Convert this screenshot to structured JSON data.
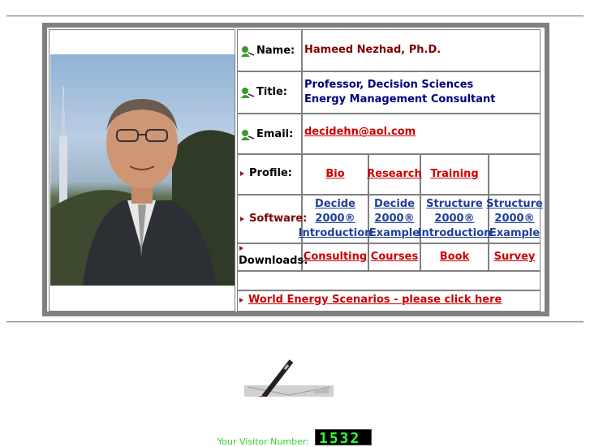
{
  "profile": {
    "name_label": "Name:",
    "name": "Hameed Nezhad, Ph.D.",
    "title_label": "Title:",
    "title_line1": "Professor, Decision Sciences",
    "title_line2": "Energy Management Consultant",
    "email_label": "Email:",
    "email": "decidehn@aol.com"
  },
  "rows": {
    "profile_label": "Profile:",
    "profile_links": [
      "Bio",
      "Research",
      "Training"
    ],
    "software_label": "Software:",
    "software_links": [
      [
        "Decide",
        "2000®",
        "Introduction"
      ],
      [
        "Decide",
        "2000®",
        "Example"
      ],
      [
        "Structure",
        "2000®",
        "Introduction"
      ],
      [
        "Structure",
        "2000®",
        "Example"
      ]
    ],
    "downloads_label": "Downloads:",
    "downloads_links": [
      "Consulting",
      "Courses",
      "Book",
      "Survey"
    ],
    "scenario_link": "World Energy Scenarios - please click here"
  },
  "counter": {
    "label": "Your Visitor Number:",
    "digits": "1532"
  },
  "colors": {
    "link": "#cc0000",
    "software_link": "#1f3f9a",
    "name_text": "#800000",
    "title_text": "#000080",
    "counter_digit": "#33ff33"
  },
  "icons": [
    "green-person-icon",
    "red-triangle-bullet-icon",
    "pen-signing-icon"
  ]
}
